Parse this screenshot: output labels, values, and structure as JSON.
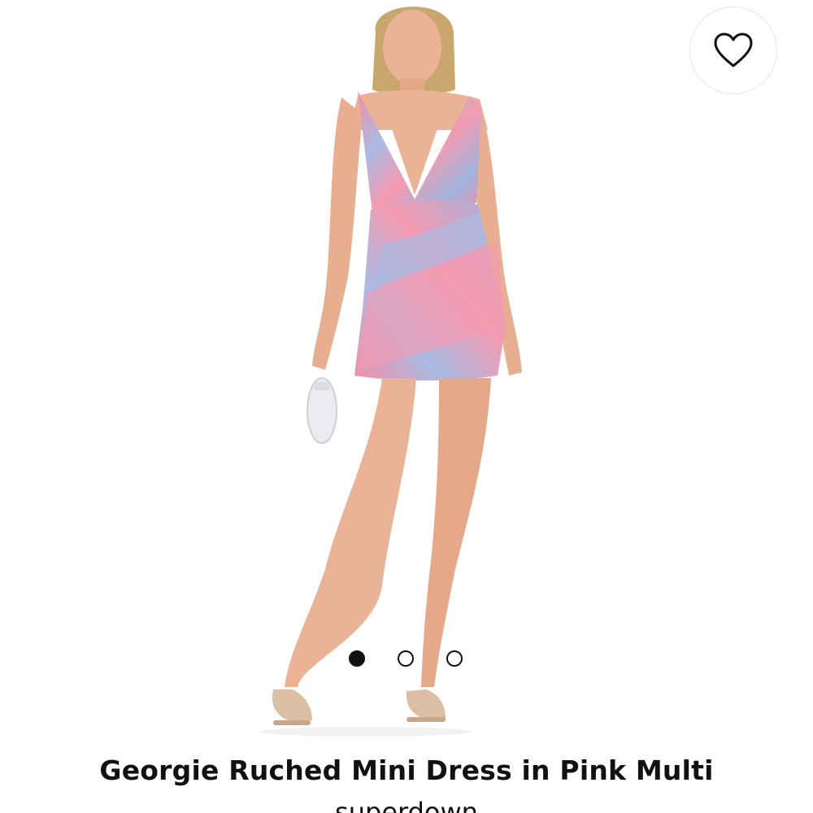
{
  "product": {
    "title": "Georgie Ruched Mini Dress in Pink Multi",
    "brand": "superdown"
  },
  "image": {
    "description_icon": "product-photo",
    "carousel": {
      "total": 3,
      "active_index": 0
    }
  },
  "favorite": {
    "icon": "heart-outline-icon"
  },
  "colors": {
    "background": "#ffffff",
    "text": "#111111",
    "dress_pink": "#f28da6",
    "dress_blue": "#9fb4e0",
    "skin": "#eab396",
    "hair": "#c9a66b",
    "sandal": "#dcbfa3"
  }
}
